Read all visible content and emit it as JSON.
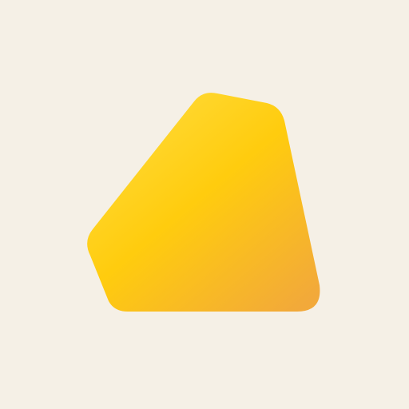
{
  "colors": {
    "background": "#F5F0E6",
    "shape_gradient_start": "#FFDB3A",
    "shape_gradient_mid": "#FFCC0E",
    "shape_gradient_end": "#F2A93A"
  },
  "graphic": {
    "icon": "rounded-irregular-polygon-shape"
  }
}
